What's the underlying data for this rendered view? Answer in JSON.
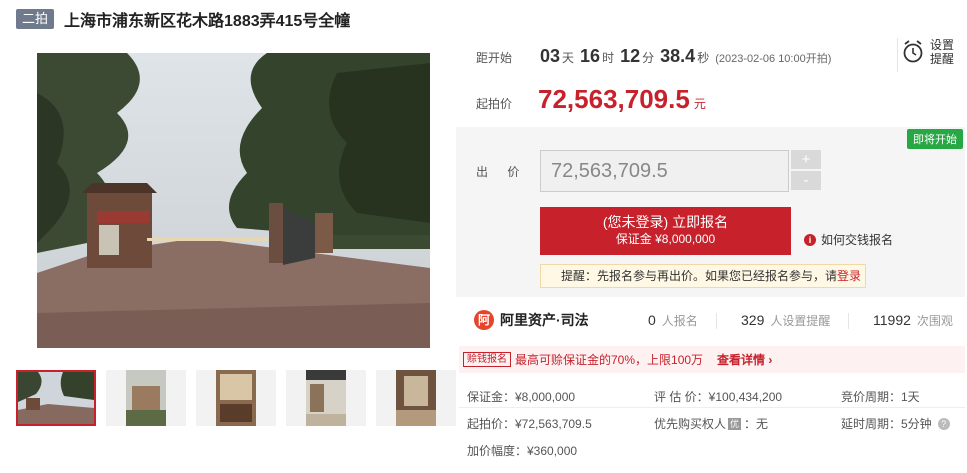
{
  "title": {
    "badge": "二拍",
    "text": "上海市浦东新区花木路1883弄415号全幢"
  },
  "countdown": {
    "label": "距开始",
    "days": "03",
    "days_unit": "天",
    "hours": "16",
    "hours_unit": "时",
    "minutes": "12",
    "minutes_unit": "分",
    "seconds": "38.4",
    "seconds_unit": "秒",
    "start_note": "(2023-02-06 10:00开拍)"
  },
  "start_price": {
    "label": "起拍价",
    "value": "72,563,709.5",
    "unit": "元"
  },
  "reminder": {
    "label": "设置提醒",
    "icon": "alarm-clock-icon"
  },
  "bid": {
    "status_badge": "即将开始",
    "label": "出 价",
    "input_value": "72,563,709.5",
    "plus": "+",
    "minus": "-",
    "signup_main": "(您未登录) 立即报名",
    "signup_sub": "保证金 ¥8,000,000",
    "how_pay_icon": "i",
    "how_pay": "如何交钱报名",
    "notice_prefix": "提醒：先报名参与再出价。如果您已经报名参与，请",
    "notice_link": "登录"
  },
  "stats": {
    "brand_logo": "阿",
    "brand": "阿里资产·司法",
    "signups": "0",
    "signups_unit": "人报名",
    "reminders": "329",
    "reminders_unit": "人设置提醒",
    "views": "11992",
    "views_unit": "次围观"
  },
  "promo": {
    "tag": "赊钱报名",
    "text": "最高可赊保证金的70%，上限100万",
    "link": "查看详情 ›"
  },
  "details": {
    "deposit": "保证金：¥8,000,000",
    "appraisal": "评 估 价：¥100,434,200",
    "cycle": "竞价周期：1天",
    "start": "起拍价：¥72,563,709.5",
    "priority_prefix": "优先购买权人",
    "priority_badge": "优",
    "priority_suffix": "：无",
    "delay": "延时周期：5分钟",
    "delay_help": "?",
    "increment": "加价幅度：¥360,000"
  },
  "colors": {
    "accent": "#c7222c",
    "badge_gray": "#6f7b8c",
    "soon_green": "#28a745"
  }
}
